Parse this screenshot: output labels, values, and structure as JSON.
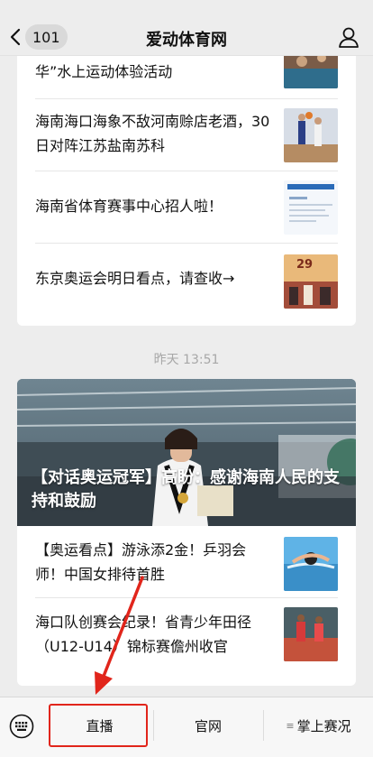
{
  "header": {
    "back_count": "101",
    "title": "爱动体育网"
  },
  "card1": {
    "items": [
      {
        "title": "华”水上运动体验活动"
      },
      {
        "title": "海南海口海象不敌河南赊店老酒，30日对阵江苏盐南苏科"
      },
      {
        "title": "海南省体育赛事中心招人啦！"
      },
      {
        "title": "东京奥运会明日看点，请查收→",
        "thumb_text": "29"
      }
    ]
  },
  "timestamp": "昨天 13:51",
  "card2": {
    "hero_title": "【对话奥运冠军】高盼：感谢海南人民的支持和鼓励",
    "items": [
      {
        "title": "【奥运看点】游泳添2金！乒羽会师！中国女排待首胜"
      },
      {
        "title": "海口队创赛会纪录！省青少年田径（U12-U14）锦标赛儋州收官"
      }
    ]
  },
  "menu": {
    "items": [
      {
        "label": "直播"
      },
      {
        "label": "官网"
      },
      {
        "label": "掌上赛况",
        "prefix": "≡"
      }
    ]
  },
  "colors": {
    "accent_red": "#e1251b",
    "background": "#ededed"
  },
  "icons": {
    "back": "chevron-left-icon",
    "profile": "user-icon",
    "keyboard": "keyboard-icon"
  }
}
